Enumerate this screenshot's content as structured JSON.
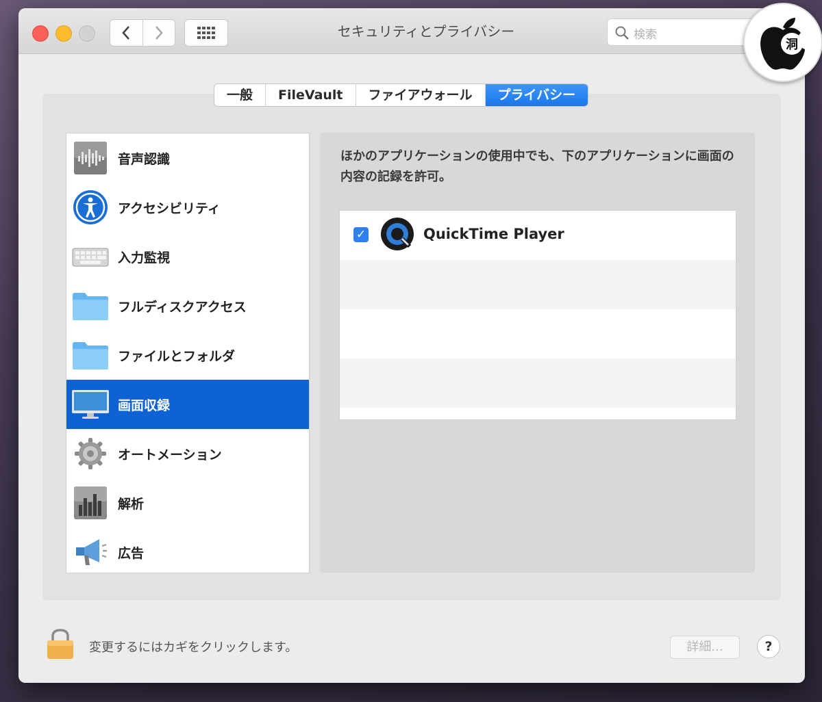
{
  "window": {
    "title": "セキュリティとプライバシー"
  },
  "toolbar": {
    "search_placeholder": "検索"
  },
  "tabs": [
    {
      "label": "一般",
      "active": false
    },
    {
      "label": "FileVault",
      "active": false
    },
    {
      "label": "ファイアウォール",
      "active": false
    },
    {
      "label": "プライバシー",
      "active": true
    }
  ],
  "sidebar": {
    "items": [
      {
        "label": "音声認識",
        "icon": "speech-recognition-icon"
      },
      {
        "label": "アクセシビリティ",
        "icon": "accessibility-icon"
      },
      {
        "label": "入力監視",
        "icon": "keyboard-icon"
      },
      {
        "label": "フルディスクアクセス",
        "icon": "folder-icon"
      },
      {
        "label": "ファイルとフォルダ",
        "icon": "folder-icon"
      },
      {
        "label": "画面収録",
        "icon": "display-icon",
        "selected": true
      },
      {
        "label": "オートメーション",
        "icon": "gear-icon"
      },
      {
        "label": "解析",
        "icon": "analytics-icon"
      },
      {
        "label": "広告",
        "icon": "megaphone-icon"
      }
    ]
  },
  "detail": {
    "description": "ほかのアプリケーションの使用中でも、下のアプリケーションに画面の内容の記録を許可。",
    "apps": [
      {
        "name": "QuickTime Player",
        "checked": true
      }
    ]
  },
  "footer": {
    "lock_text": "変更するにはカギをクリックします。",
    "advanced_label": "詳細...",
    "help_label": "?"
  },
  "watermark": {
    "text": "洞"
  },
  "colors": {
    "accent": "#1a77ea",
    "selection": "#0f62d3"
  }
}
